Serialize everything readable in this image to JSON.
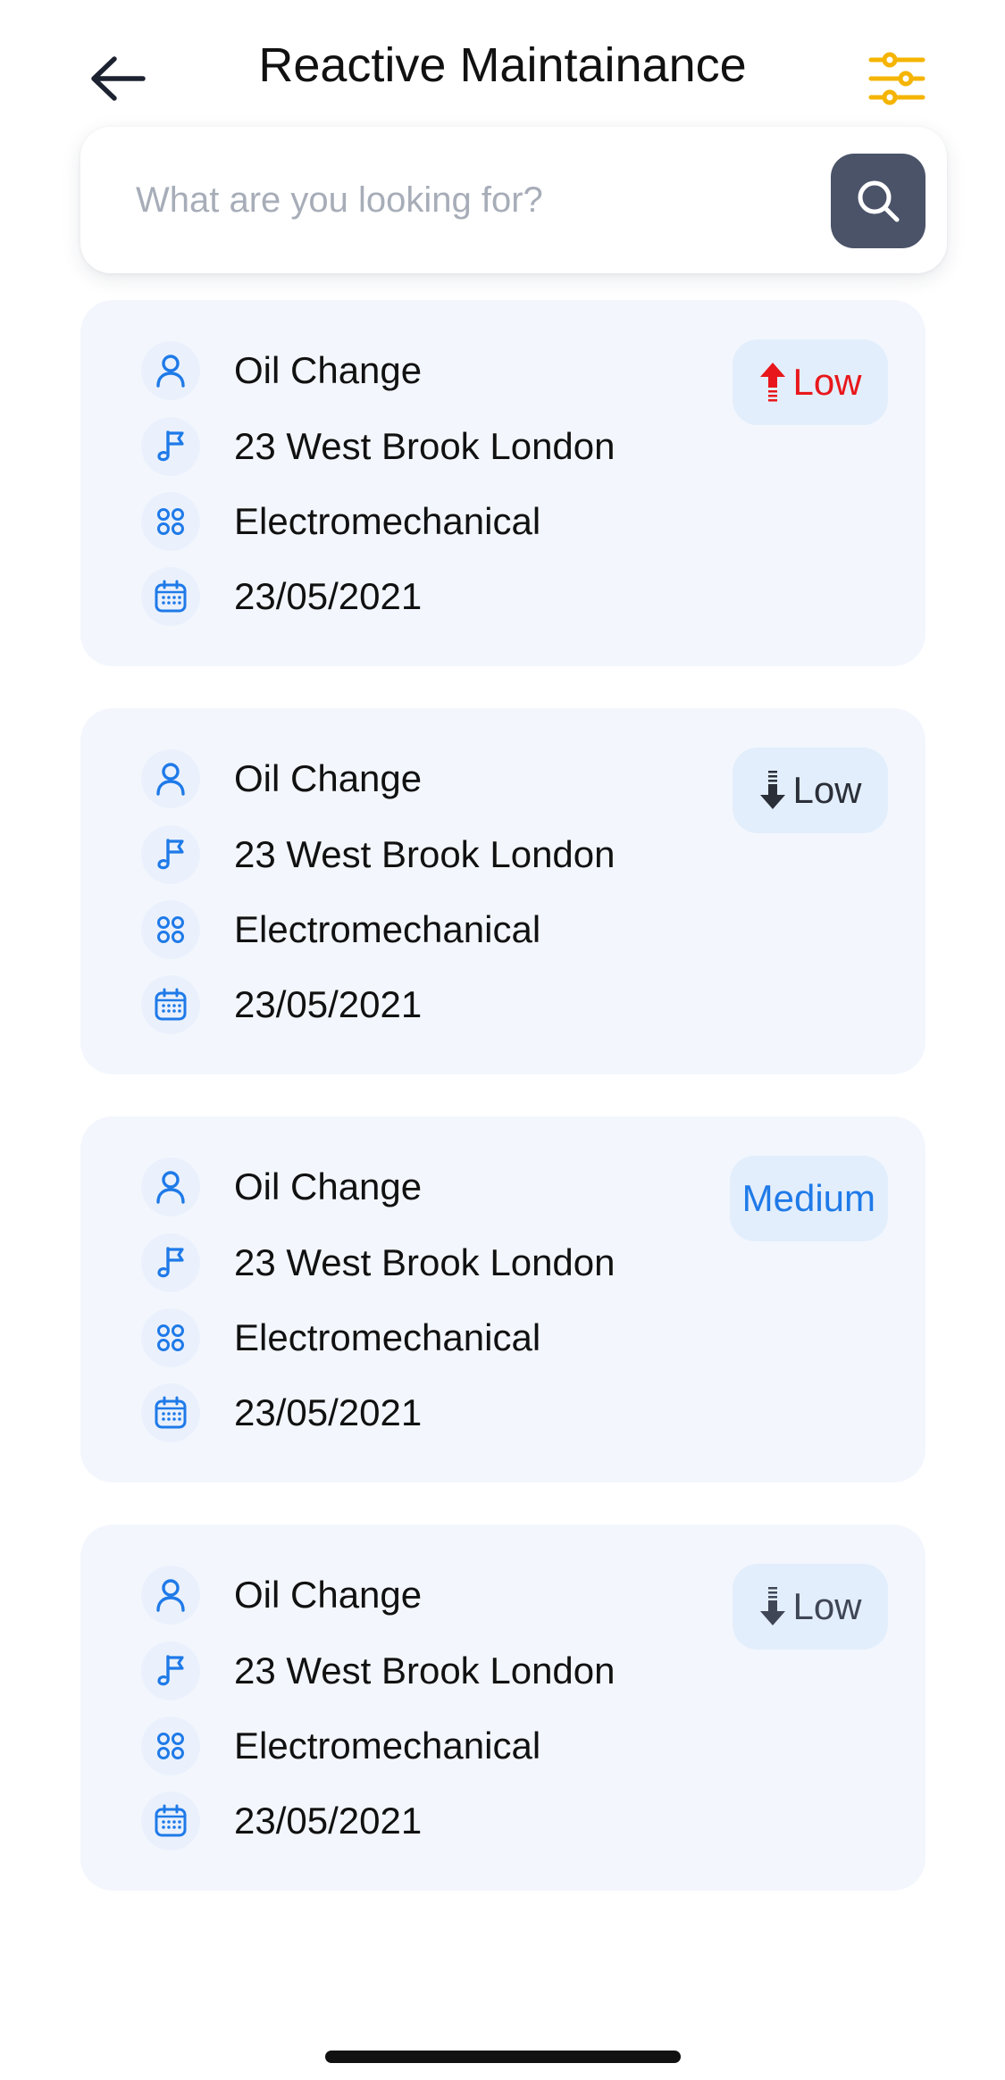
{
  "header": {
    "title": "Reactive Maintainance",
    "back_icon": "arrow-left-icon",
    "filter_icon": "sliders-icon",
    "filter_color": "#f5b400"
  },
  "search": {
    "placeholder": "What are you looking for?",
    "value": "",
    "button_icon": "search-icon",
    "button_color": "#4a5368"
  },
  "colors": {
    "accent_blue": "#1f7ae8",
    "card_bg": "#f3f7fd",
    "badge_bg": "#e3eefc",
    "priority_high_red": "#e8171b",
    "priority_dark": "#2b2f38",
    "priority_medium_blue": "#1f7ae8",
    "priority_muted": "#3f4656"
  },
  "cards": [
    {
      "title": "Oil Change",
      "location": "23 West Brook London",
      "category": "Electromechanical",
      "date": "23/05/2021",
      "priority": {
        "label": "Low",
        "icon": "arrow-up-icon",
        "color": "#e8171b"
      }
    },
    {
      "title": "Oil Change",
      "location": "23 West Brook London",
      "category": "Electromechanical",
      "date": "23/05/2021",
      "priority": {
        "label": "Low",
        "icon": "arrow-down-icon",
        "color": "#2b2f38"
      }
    },
    {
      "title": "Oil Change",
      "location": "23 West Brook London",
      "category": "Electromechanical",
      "date": "23/05/2021",
      "priority": {
        "label": "Medium",
        "icon": "",
        "color": "#1f7ae8"
      }
    },
    {
      "title": "Oil Change",
      "location": "23 West Brook London",
      "category": "Electromechanical",
      "date": "23/05/2021",
      "priority": {
        "label": "Low",
        "icon": "arrow-down-icon",
        "color": "#3f4656"
      }
    }
  ],
  "row_icons": [
    "user-icon",
    "location-flag-icon",
    "category-grid-icon",
    "calendar-icon"
  ]
}
